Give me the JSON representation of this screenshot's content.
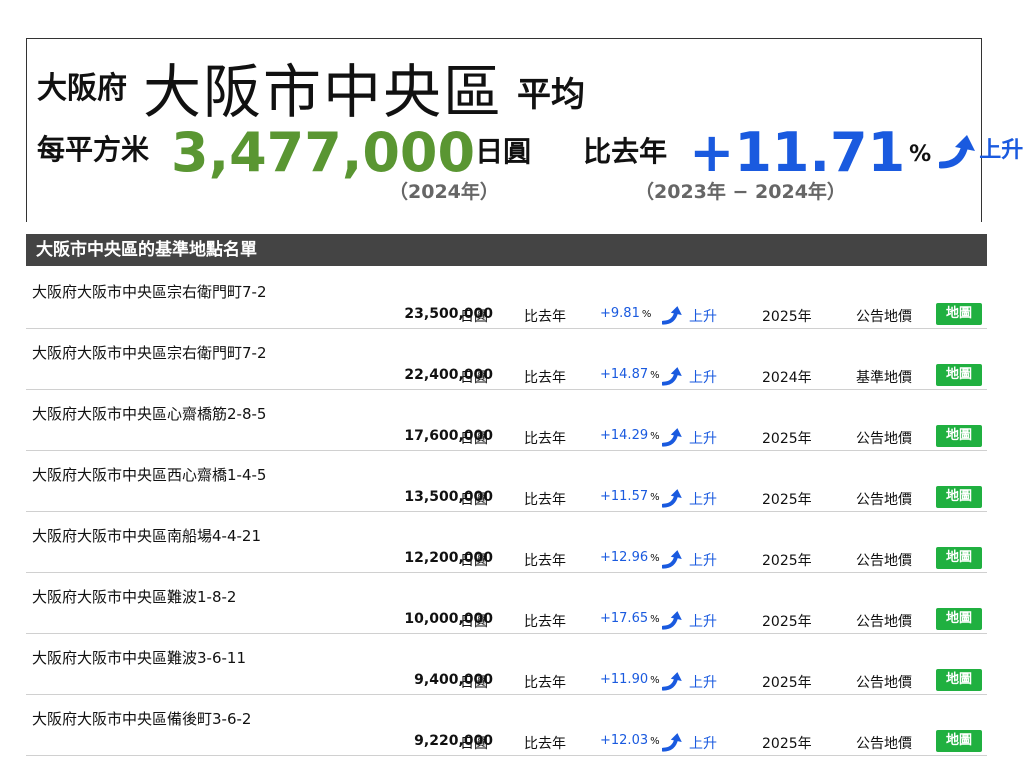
{
  "header": {
    "prefecture": "大阪府",
    "ward": "大阪市中央區",
    "avg_label": "平均",
    "unit_prefix": "每平方米",
    "price": "3,477,000",
    "currency": "日圓",
    "cmp_label": "比去年",
    "pct": "+11.71",
    "pct_sign": "%",
    "trend": "上升",
    "price_year": "（2024年）",
    "cmp_range": "（2023年 − 2024年）"
  },
  "list": {
    "title": "大阪市中央區的基準地點名單",
    "rows": [
      {
        "address": "大阪府大阪市中央區宗右衛門町7-2",
        "price": "23,500,000",
        "currency": "日圓",
        "cmp": "比去年",
        "pct": "+9.81",
        "pct_sign": "%",
        "trend": "上升",
        "year": "2025年",
        "type": "公告地價",
        "map": "地圖"
      },
      {
        "address": "大阪府大阪市中央區宗右衛門町7-2",
        "price": "22,400,000",
        "currency": "日圓",
        "cmp": "比去年",
        "pct": "+14.87",
        "pct_sign": "%",
        "trend": "上升",
        "year": "2024年",
        "type": "基準地價",
        "map": "地圖"
      },
      {
        "address": "大阪府大阪市中央區心齋橋筋2-8-5",
        "price": "17,600,000",
        "currency": "日圓",
        "cmp": "比去年",
        "pct": "+14.29",
        "pct_sign": "%",
        "trend": "上升",
        "year": "2025年",
        "type": "公告地價",
        "map": "地圖"
      },
      {
        "address": "大阪府大阪市中央區西心齋橋1-4-5",
        "price": "13,500,000",
        "currency": "日圓",
        "cmp": "比去年",
        "pct": "+11.57",
        "pct_sign": "%",
        "trend": "上升",
        "year": "2025年",
        "type": "公告地價",
        "map": "地圖"
      },
      {
        "address": "大阪府大阪市中央區南船場4-4-21",
        "price": "12,200,000",
        "currency": "日圓",
        "cmp": "比去年",
        "pct": "+12.96",
        "pct_sign": "%",
        "trend": "上升",
        "year": "2025年",
        "type": "公告地價",
        "map": "地圖"
      },
      {
        "address": "大阪府大阪市中央區難波1-8-2",
        "price": "10,000,000",
        "currency": "日圓",
        "cmp": "比去年",
        "pct": "+17.65",
        "pct_sign": "%",
        "trend": "上升",
        "year": "2025年",
        "type": "公告地價",
        "map": "地圖"
      },
      {
        "address": "大阪府大阪市中央區難波3-6-11",
        "price": "9,400,000",
        "currency": "日圓",
        "cmp": "比去年",
        "pct": "+11.90",
        "pct_sign": "%",
        "trend": "上升",
        "year": "2025年",
        "type": "公告地價",
        "map": "地圖"
      },
      {
        "address": "大阪府大阪市中央區備後町3-6-2",
        "price": "9,220,000",
        "currency": "日圓",
        "cmp": "比去年",
        "pct": "+12.03",
        "pct_sign": "%",
        "trend": "上升",
        "year": "2025年",
        "type": "公告地價",
        "map": "地圖"
      }
    ]
  },
  "colors": {
    "price_green": "#5a9632",
    "up_blue": "#1a5adf",
    "map_green": "#20b040",
    "header_bar": "#444444"
  },
  "icons": {
    "trend": "up-arrow-icon"
  }
}
